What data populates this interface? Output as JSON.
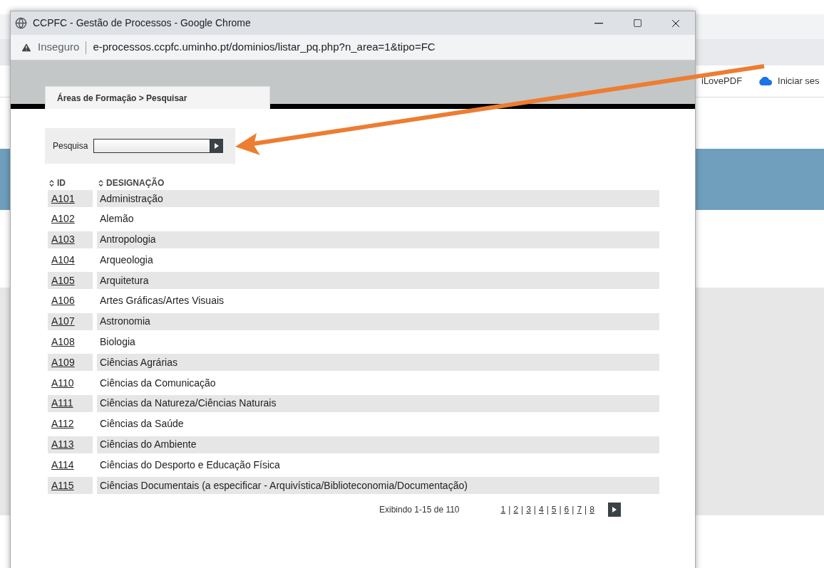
{
  "background_browser": {
    "bookmarks": [
      {
        "label": "iLovePDF",
        "kind": "text"
      },
      {
        "label": "Iniciar ses",
        "kind": "cloud"
      }
    ]
  },
  "window": {
    "title": "CCPFC - Gestão de Processos - Google Chrome",
    "security": "Inseguro",
    "url": "e-processos.ccpfc.uminho.pt/dominios/listar_pq.php?n_area=1&tipo=FC"
  },
  "breadcrumb_tab": "Áreas de Formação > Pesquisar",
  "search": {
    "label": "Pesquisa"
  },
  "table": {
    "columns": [
      "ID",
      "DESIGNAÇÃO"
    ],
    "rows": [
      {
        "id": "A101",
        "name": "Administração"
      },
      {
        "id": "A102",
        "name": "Alemão"
      },
      {
        "id": "A103",
        "name": "Antropologia"
      },
      {
        "id": "A104",
        "name": "Arqueologia"
      },
      {
        "id": "A105",
        "name": "Arquitetura"
      },
      {
        "id": "A106",
        "name": "Artes Gráficas/Artes Visuais"
      },
      {
        "id": "A107",
        "name": "Astronomia"
      },
      {
        "id": "A108",
        "name": "Biologia"
      },
      {
        "id": "A109",
        "name": "Ciências Agrárias"
      },
      {
        "id": "A110",
        "name": "Ciências da Comunicação"
      },
      {
        "id": "A111",
        "name": "Ciências da Natureza/Ciências Naturais"
      },
      {
        "id": "A112",
        "name": "Ciências da Saúde"
      },
      {
        "id": "A113",
        "name": "Ciências do Ambiente"
      },
      {
        "id": "A114",
        "name": "Ciências do Desporto e Educação Física"
      },
      {
        "id": "A115",
        "name": "Ciências Documentais (a especificar - Arquivística/Biblioteconomia/Documentação)"
      }
    ]
  },
  "pagination": {
    "summary": "Exibindo 1-15 de 110",
    "pages": [
      "1",
      "2",
      "3",
      "4",
      "5",
      "6",
      "7",
      "8"
    ],
    "separator": "|"
  }
}
